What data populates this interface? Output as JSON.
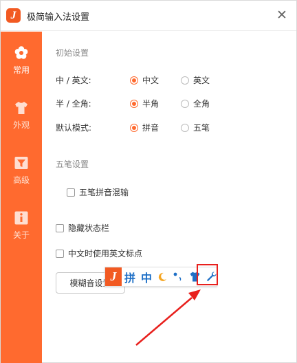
{
  "window": {
    "title": "极简输入法设置",
    "close_glyph": "✕"
  },
  "sidebar": {
    "items": [
      {
        "label": "常用",
        "icon": "flower-icon",
        "active": true
      },
      {
        "label": "外观",
        "icon": "shirt-icon",
        "active": false
      },
      {
        "label": "高级",
        "icon": "filter-icon",
        "active": false
      },
      {
        "label": "关于",
        "icon": "info-icon",
        "active": false
      }
    ]
  },
  "initial": {
    "title": "初始设置",
    "rows": [
      {
        "label": "中 / 英文:",
        "options": [
          "中文",
          "英文"
        ],
        "selected": 0
      },
      {
        "label": "半 / 全角:",
        "options": [
          "半角",
          "全角"
        ],
        "selected": 0
      },
      {
        "label": "默认模式:",
        "options": [
          "拼音",
          "五笔"
        ],
        "selected": 0
      }
    ]
  },
  "wubi": {
    "title": "五笔设置",
    "mixed_label": "五笔拼音混输"
  },
  "options": {
    "hide_status_bar": "隐藏状态栏",
    "english_punct": "中文时使用英文标点"
  },
  "fuzzy_button": "模糊音设置",
  "ime_bar": {
    "logo": "J",
    "pinyin": "拼",
    "chinese": "中",
    "moon_icon": "moon-icon",
    "punct_icon": "punctuation-icon",
    "skin_icon": "shirt-icon",
    "settings_icon": "wrench-icon"
  },
  "colors": {
    "accent": "#ff6a2f",
    "ime_blue": "#1e6fc6",
    "annotation_red": "#e8201d"
  }
}
